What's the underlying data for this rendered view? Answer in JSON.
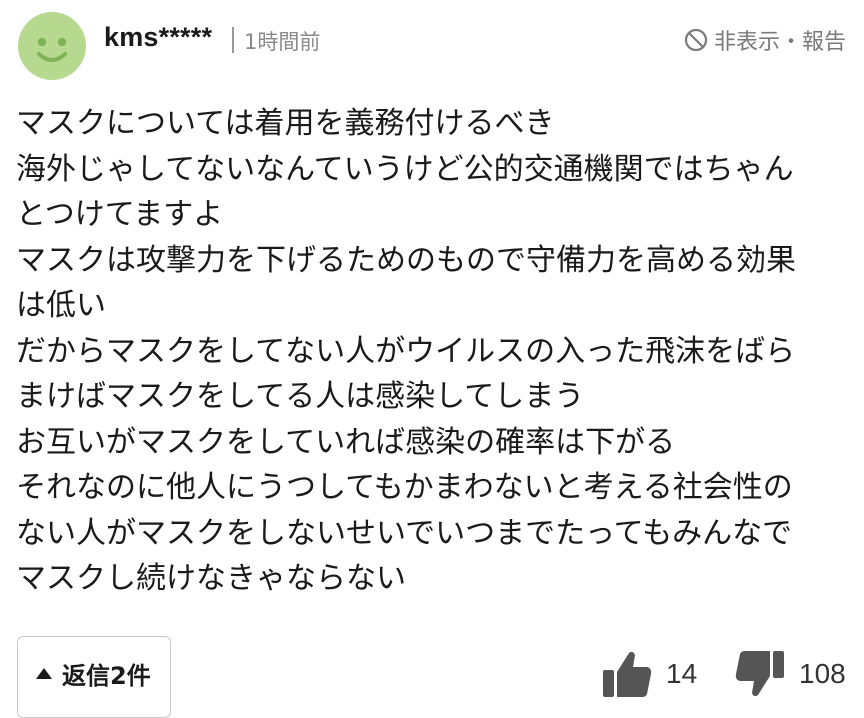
{
  "comment": {
    "username": "kms*****",
    "time": "1時間前",
    "report_label": "非表示・報告",
    "lines": [
      "マスクについては着用を義務付けるべき",
      "海外じゃしてないなんていうけど公的交通機関ではちゃん",
      "とつけてますよ",
      "マスクは攻撃力を下げるためのもので守備力を高める効果",
      "は低い",
      "だからマスクをしてない人がウイルスの入った飛沫をばら",
      "まけばマスクをしてる人は感染してしまう",
      "お互いがマスクをしていれば感染の確率は下がる",
      "それなのに他人にうつしてもかまわないと考える社会性の",
      "ない人がマスクをしないせいでいつまでたってもみんなで",
      "マスクし続けなきゃならない"
    ],
    "reply_label": "返信2件",
    "likes": "14",
    "dislikes": "108"
  },
  "colors": {
    "avatar_bg": "#b6d88f",
    "avatar_face": "#7fb456",
    "text": "#1a1a1a",
    "meta": "#8a8a8a",
    "icon_gray": "#555555"
  },
  "icons": {
    "avatar": "smile-face-icon",
    "report": "prohibited-icon",
    "reply": "triangle-up-icon",
    "like": "thumbs-up-icon",
    "dislike": "thumbs-down-icon"
  }
}
